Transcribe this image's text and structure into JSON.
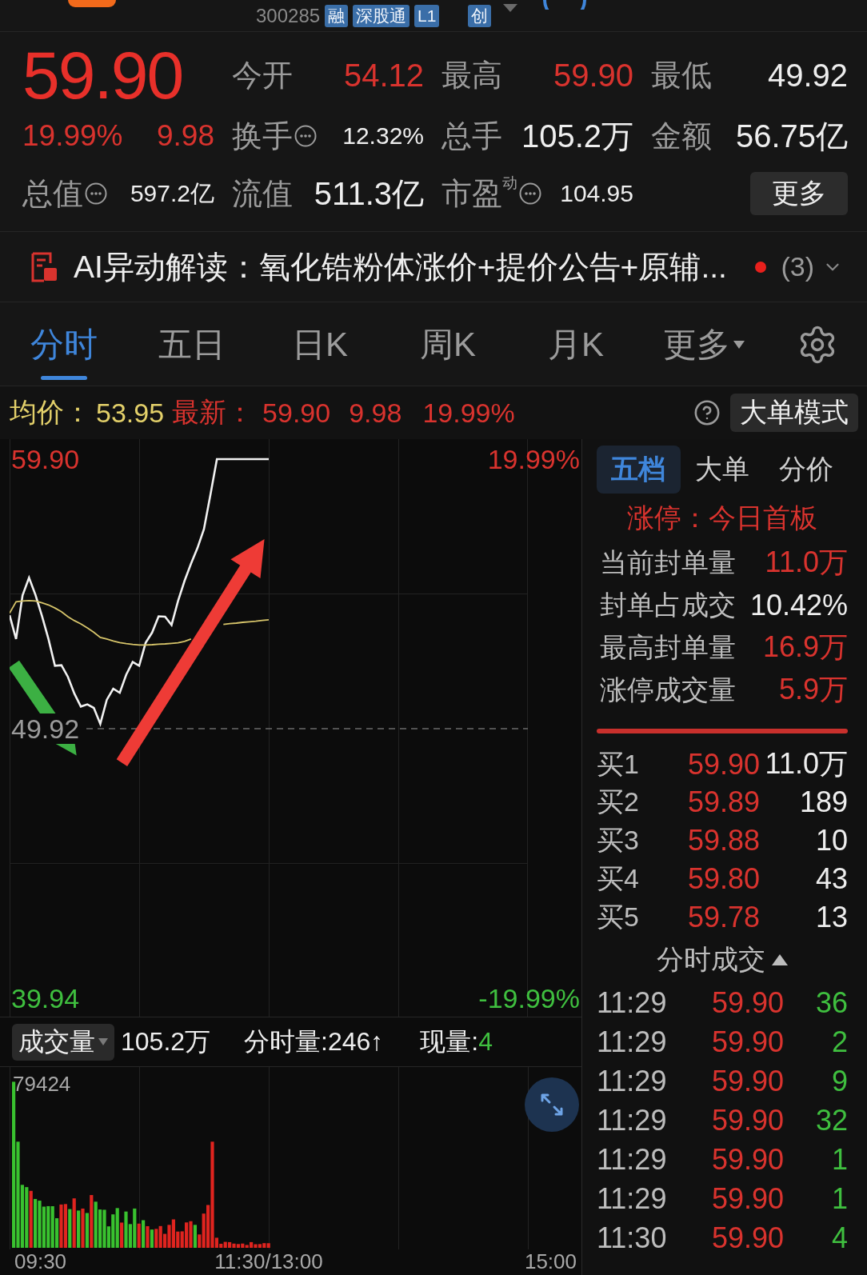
{
  "header": {
    "code": "300285",
    "tags": [
      "融",
      "深股通",
      "L1",
      "创"
    ]
  },
  "quote": {
    "price": "59.90",
    "change_pct": "19.99%",
    "change": "9.98",
    "stats": [
      {
        "label": "今开",
        "value": "54.12",
        "color": "#d9332e",
        "info": false
      },
      {
        "label": "最高",
        "value": "59.90",
        "color": "#d9332e",
        "info": false
      },
      {
        "label": "最低",
        "value": "49.92",
        "color": "#eeeeee",
        "info": false
      },
      {
        "label": "换手",
        "value": "12.32%",
        "color": "#eeeeee",
        "info": true
      },
      {
        "label": "总手",
        "value": "105.2万",
        "color": "#eeeeee",
        "info": false
      },
      {
        "label": "金额",
        "value": "56.75亿",
        "color": "#eeeeee",
        "info": false
      },
      {
        "label": "总值",
        "value": "597.2亿",
        "color": "#eeeeee",
        "info": true
      },
      {
        "label": "流值",
        "value": "511.3亿",
        "color": "#eeeeee",
        "info": false
      },
      {
        "label": "市盈$^{动}$",
        "value": "104.95",
        "color": "#eeeeee",
        "info": true
      }
    ],
    "more_button": "更多"
  },
  "ai_summary": {
    "text": "AI异动解读：氧化锆粉体涨价+提价公告+原辅...",
    "unread": true,
    "count": "(3)"
  },
  "chart_tabs": [
    {
      "label": "分时",
      "selected": true,
      "kind": "tab"
    },
    {
      "label": "五日",
      "selected": false,
      "kind": "tab"
    },
    {
      "label": "日K",
      "selected": false,
      "kind": "tab"
    },
    {
      "label": "周K",
      "selected": false,
      "kind": "tab"
    },
    {
      "label": "月K",
      "selected": false,
      "kind": "tab"
    },
    {
      "label": "更多",
      "selected": false,
      "kind": "menu"
    }
  ],
  "info_bar": {
    "average": {
      "label": "均价：",
      "value": "53.95"
    },
    "latest": {
      "label": "最新：",
      "values": [
        "59.90",
        "9.98",
        "19.99%"
      ]
    },
    "mode_button": "大单模式"
  },
  "price_chart": {
    "chart_data": {
      "type": "line",
      "categories": [
        null,
        null,
        null,
        null,
        null,
        null,
        null,
        null,
        null,
        null,
        null,
        null,
        null,
        null,
        null,
        null,
        null,
        null,
        null,
        null,
        null,
        null,
        null,
        null,
        null,
        null,
        null,
        null,
        null,
        null,
        null,
        null,
        null,
        null,
        null,
        null,
        null,
        null,
        null,
        null,
        null,
        null,
        null,
        null,
        null,
        null,
        null,
        null,
        null,
        null,
        null,
        null,
        null,
        null,
        null,
        null,
        null,
        null,
        null,
        null,
        null,
        null,
        null,
        null,
        null,
        null,
        null,
        null,
        null,
        null,
        null,
        null,
        null,
        null,
        null,
        null,
        null,
        null,
        null,
        null,
        null
      ],
      "ylim": [
        39.26,
        60.64
      ],
      "yticks": [
        {
          "value": 59.9,
          "label": "59.90"
        },
        {
          "value": 49.92,
          "label": "49.92"
        },
        {
          "value": 39.94,
          "label": "39.94"
        }
      ],
      "series": [
        {
          "color": "#f2f2f2",
          "values": [
            54.12,
            53.24,
            54.86,
            55.51,
            54.87,
            54.09,
            53.24,
            52.25,
            52.27,
            51.84,
            51.22,
            50.74,
            50.82,
            50.69,
            50.1,
            50.99,
            51.4,
            51.25,
            51.92,
            52.39,
            52.25,
            53.1,
            53.48,
            54.08,
            54.07,
            53.76,
            54.65,
            55.39,
            56.03,
            56.61,
            57.31,
            58.58,
            59.9,
            59.9,
            59.9,
            59.9,
            59.9,
            59.9,
            59.9,
            59.9,
            59.9,
            null,
            null,
            null,
            null,
            null,
            null,
            null,
            null,
            null,
            null,
            null,
            null,
            null,
            null,
            null,
            null,
            null,
            null,
            null,
            null,
            null,
            null,
            null,
            null,
            null,
            null,
            null,
            null,
            null,
            null,
            null,
            null,
            null,
            null,
            null,
            null,
            null,
            null,
            null,
            null
          ]
        },
        {
          "color": "#d6c46a",
          "values": [
            54.2,
            54.62,
            54.65,
            54.66,
            54.65,
            54.58,
            54.5,
            54.39,
            54.25,
            54.07,
            53.92,
            53.8,
            53.65,
            53.49,
            53.3,
            53.24,
            53.17,
            53.11,
            53.07,
            53.04,
            53.02,
            53.02,
            53.03,
            53.05,
            53.06,
            53.08,
            53.1,
            53.15,
            53.24,
            null,
            null,
            null,
            null,
            53.78,
            53.81,
            53.83,
            53.86,
            53.88,
            53.9,
            53.93,
            53.95,
            null,
            null,
            null,
            null,
            null,
            null,
            null,
            null,
            null,
            null,
            null,
            null,
            null,
            null,
            null,
            null,
            null,
            null,
            null,
            null,
            null,
            null,
            null,
            null,
            null,
            null,
            null,
            null,
            null,
            null,
            null,
            null,
            null,
            null,
            null,
            null,
            null,
            null,
            null,
            null
          ]
        }
      ],
      "ref_lines": [
        {
          "axis": "y",
          "value": 49.92
        }
      ]
    },
    "right_labels": [
      {
        "label": "19.99%",
        "color": "#d9332e"
      },
      {
        "label": "-19.99%",
        "color": "#3fbf3f"
      }
    ],
    "arrows": [
      {
        "kind": "falling",
        "color": "#3cb043"
      },
      {
        "kind": "rising",
        "color": "#ee3b36"
      }
    ]
  },
  "volume": {
    "selector": "成交量",
    "total": "105.2万",
    "minute_volume": "分时量:246↑",
    "current": {
      "label": "现量:",
      "value": "4",
      "color": "#3fbf3f"
    },
    "scale_label": "79424",
    "time_axis": [
      "09:30",
      "11:30/13:00",
      "15:00"
    ]
  },
  "order_panel": {
    "tabs": [
      {
        "label": "五档",
        "selected": true
      },
      {
        "label": "大单",
        "selected": false
      },
      {
        "label": "分价",
        "selected": false
      }
    ],
    "limit_status": "涨停：今日首板",
    "stats": [
      {
        "label": "当前封单量",
        "value": "11.0万",
        "color": "#d9332e"
      },
      {
        "label": "封单占成交",
        "value": "10.42%",
        "color": "#eeeeee"
      },
      {
        "label": "最高封单量",
        "value": "16.9万",
        "color": "#d9332e"
      },
      {
        "label": "涨停成交量",
        "value": "5.9万",
        "color": "#d9332e"
      }
    ],
    "bids": [
      {
        "label": "买1",
        "price": "59.90",
        "volume": "11.0万"
      },
      {
        "label": "买2",
        "price": "59.89",
        "volume": "189"
      },
      {
        "label": "买3",
        "price": "59.88",
        "volume": "10"
      },
      {
        "label": "买4",
        "price": "59.80",
        "volume": "43"
      },
      {
        "label": "买5",
        "price": "59.78",
        "volume": "13"
      }
    ],
    "trades_header": "分时成交",
    "trades": [
      {
        "time": "11:29",
        "price": "59.90",
        "volume": "36",
        "color": "#3fbf3f"
      },
      {
        "time": "11:29",
        "price": "59.90",
        "volume": "2",
        "color": "#3fbf3f"
      },
      {
        "time": "11:29",
        "price": "59.90",
        "volume": "9",
        "color": "#3fbf3f"
      },
      {
        "time": "11:29",
        "price": "59.90",
        "volume": "32",
        "color": "#3fbf3f"
      },
      {
        "time": "11:29",
        "price": "59.90",
        "volume": "1",
        "color": "#3fbf3f"
      },
      {
        "time": "11:29",
        "price": "59.90",
        "volume": "1",
        "color": "#3fbf3f"
      },
      {
        "time": "11:30",
        "price": "59.90",
        "volume": "4",
        "color": "#3fbf3f"
      }
    ]
  }
}
